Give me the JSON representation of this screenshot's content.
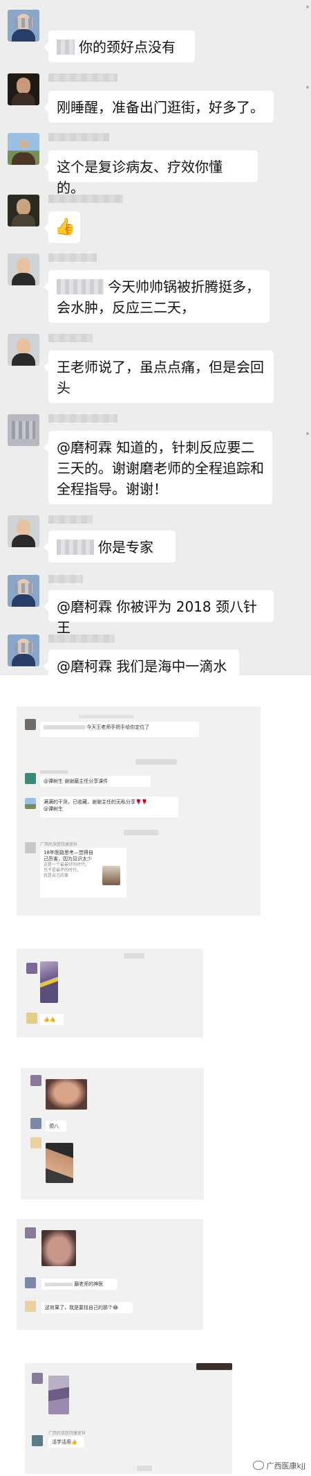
{
  "messages": [
    {
      "text": "你的颈好点没有"
    },
    {
      "text": "刚睡醒，准备出门逛街，好多了。"
    },
    {
      "text": "这个是复诊病友、疗效你懂的。"
    },
    {
      "text": "👍"
    },
    {
      "line1": "今天帅帅锅被折腾挺多，",
      "line2": "会水肿，反应三二天，"
    },
    {
      "line1": "王老师说了，虽点点痛，但是会回",
      "line2": "头"
    },
    {
      "line1": "@磨柯霖  知道的，针刺反应要二",
      "line2": "三天的。谢谢磨老师的全程追踪和",
      "line3": "全程指导。谢谢！"
    },
    {
      "text": "你是专家"
    },
    {
      "text": "@磨柯霖  你被评为 2018 颈八针王"
    },
    {
      "text": "@磨柯霖  我们是海中一滴水"
    }
  ],
  "screenshots": {
    "shot1": {
      "header": "广西中医药",
      "msg1": "今天王老师手把手给你定位了",
      "msg2": "@谭树生 谢谢磨主任分享课件",
      "msg3": "满满的干货，已收藏，谢谢主任的无私分享🌹🌹",
      "msg3b": "@谭树生",
      "card_sender": "广西民族医院康复科",
      "card_title": "18年医路思考—觉得自己厉害，因为见识太少",
      "card_sub1": "这是一个最最好的时代，",
      "card_sub2": "也不是最坏的时代，",
      "card_sub3": "我是自己的事"
    },
    "shot2": {
      "thumbs": "👍👍"
    },
    "shot3": {
      "msg": "颈八"
    },
    "shot4": {
      "msg1": "磨老师的神医",
      "msg2": "这效果了，我是要找自己的那个😂"
    },
    "shot5": {
      "sender": "广西民族医院康复科",
      "msg": "活学活用👍"
    }
  },
  "watermark": "广西医康kjj"
}
